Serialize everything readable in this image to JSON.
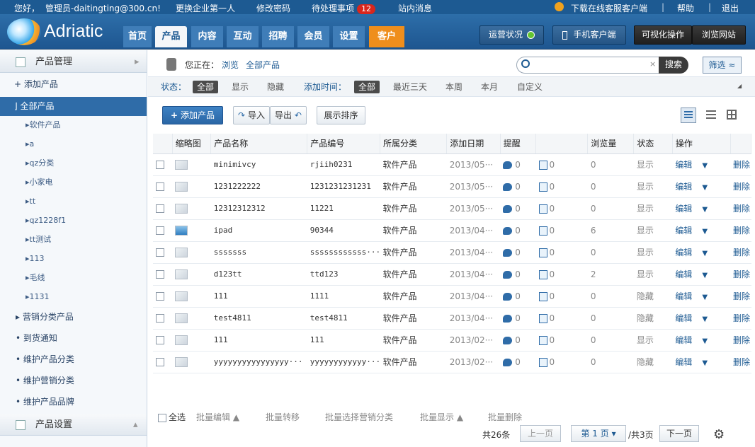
{
  "topbar": {
    "greeting": "您好，",
    "user": "管理员-daitingting@300.cn!",
    "switch_company": "更换企业第一人",
    "change_password": "修改密码",
    "pending": "待处理事项",
    "pending_count": "12",
    "messages": "站内消息",
    "download": "下载在线客服客户端",
    "help": "帮助",
    "logout": "退出"
  },
  "header": {
    "logo": "Adriatic",
    "nav": [
      "首页",
      "产品",
      "内容",
      "互动",
      "招聘",
      "会员",
      "设置",
      "客户"
    ],
    "status_label": "运营状况",
    "mobile": "手机客户端",
    "visual": "可视化操作",
    "browse": "浏览网站"
  },
  "sidebar": {
    "section1": "产品管理",
    "add_product": "+ 添加产品",
    "all_products": "⌋ 全部产品",
    "categories": [
      "▸软件产品",
      "▸a",
      "▸qz分类",
      "▸小家电",
      "▸tt",
      "▸qz1228f1",
      "▸tt测试",
      "▸113",
      "▸毛线",
      "▸1131"
    ],
    "more": [
      "▸ 营销分类产品",
      "• 到货通知",
      "• 维护产品分类",
      "• 维护营销分类",
      "• 维护产品品牌"
    ],
    "section2": "产品设置"
  },
  "crumb": {
    "prefix": "您正在：",
    "link1": "浏览",
    "link2": "全部产品",
    "search_placeholder": "",
    "search_btn": "搜索",
    "filter_btn": "筛选"
  },
  "filters": {
    "status_label": "状态：",
    "status": [
      "全部",
      "显示",
      "隐藏"
    ],
    "time_label": "添加时间：",
    "time": [
      "全部",
      "最近三天",
      "本周",
      "本月",
      "自定义"
    ]
  },
  "toolbar": {
    "add": "添加产品",
    "import": "导入",
    "export": "导出",
    "sort": "展示排序"
  },
  "table": {
    "headers": [
      "缩略图",
      "产品名称",
      "产品编号",
      "所属分类",
      "添加日期",
      "提醒",
      "",
      "浏览量",
      "状态",
      "操作",
      ""
    ],
    "rows": [
      {
        "name": "minimivcy",
        "code": "rjiih0231",
        "cat": "软件产品",
        "date": "2013/05···",
        "c1": "0",
        "c2": "0",
        "views": "0",
        "status": "显示",
        "img": false
      },
      {
        "name": "1231222222",
        "code": "1231231231231",
        "cat": "软件产品",
        "date": "2013/05···",
        "c1": "0",
        "c2": "0",
        "views": "0",
        "status": "显示",
        "img": false
      },
      {
        "name": "12312312312",
        "code": "11221",
        "cat": "软件产品",
        "date": "2013/05···",
        "c1": "0",
        "c2": "0",
        "views": "0",
        "status": "显示",
        "img": false
      },
      {
        "name": "ipad",
        "code": "90344",
        "cat": "软件产品",
        "date": "2013/04···",
        "c1": "0",
        "c2": "0",
        "views": "6",
        "status": "显示",
        "img": true
      },
      {
        "name": "sssssss",
        "code": "ssssssssssss···",
        "cat": "软件产品",
        "date": "2013/04···",
        "c1": "0",
        "c2": "0",
        "views": "0",
        "status": "显示",
        "img": false
      },
      {
        "name": "d123tt",
        "code": "ttd123",
        "cat": "软件产品",
        "date": "2013/04···",
        "c1": "0",
        "c2": "0",
        "views": "2",
        "status": "显示",
        "img": false
      },
      {
        "name": "111",
        "code": "1111",
        "cat": "软件产品",
        "date": "2013/04···",
        "c1": "0",
        "c2": "0",
        "views": "0",
        "status": "隐藏",
        "img": false
      },
      {
        "name": "test4811",
        "code": "test4811",
        "cat": "软件产品",
        "date": "2013/04···",
        "c1": "0",
        "c2": "0",
        "views": "0",
        "status": "隐藏",
        "img": false
      },
      {
        "name": "111",
        "code": "111",
        "cat": "软件产品",
        "date": "2013/02···",
        "c1": "0",
        "c2": "0",
        "views": "0",
        "status": "显示",
        "img": false
      },
      {
        "name": "yyyyyyyyyyyyyyyy···",
        "code": "yyyyyyyyyyyy···",
        "cat": "软件产品",
        "date": "2013/02···",
        "c1": "0",
        "c2": "0",
        "views": "0",
        "status": "隐藏",
        "img": false
      }
    ],
    "edit": "编辑",
    "delete": "删除"
  },
  "footer": {
    "select_all": "全选",
    "batch_edit": "批量编辑 ▲",
    "batch_move": "批量转移",
    "batch_category": "批量选择营销分类",
    "batch_show": "批量显示 ▲",
    "batch_delete": "批量删除",
    "total": "共26条",
    "prev": "上一页",
    "page_prefix": "第",
    "page": "1",
    "page_suffix": "页",
    "of_pages": "/共3页",
    "next": "下一页"
  }
}
